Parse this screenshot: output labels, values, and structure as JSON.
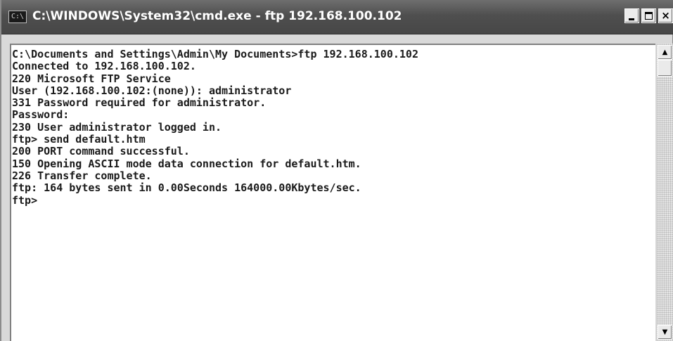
{
  "window": {
    "icon_label": "C:\\",
    "title": "C:\\WINDOWS\\System32\\cmd.exe - ftp 192.168.100.102",
    "minimize_icon": "minimize-icon",
    "maximize_icon": "maximize-icon",
    "close_symbol": "×"
  },
  "console": {
    "lines": [
      "C:\\Documents and Settings\\Admin\\My Documents>ftp 192.168.100.102",
      "Connected to 192.168.100.102.",
      "220 Microsoft FTP Service",
      "User (192.168.100.102:(none)): administrator",
      "331 Password required for administrator.",
      "Password:",
      "230 User administrator logged in.",
      "ftp> send default.htm",
      "200 PORT command successful.",
      "150 Opening ASCII mode data connection for default.htm.",
      "226 Transfer complete.",
      "ftp: 164 bytes sent in 0.00Seconds 164000.00Kbytes/sec.",
      "ftp>"
    ]
  },
  "scrollbar": {
    "up_symbol": "▲",
    "down_symbol": "▼"
  }
}
